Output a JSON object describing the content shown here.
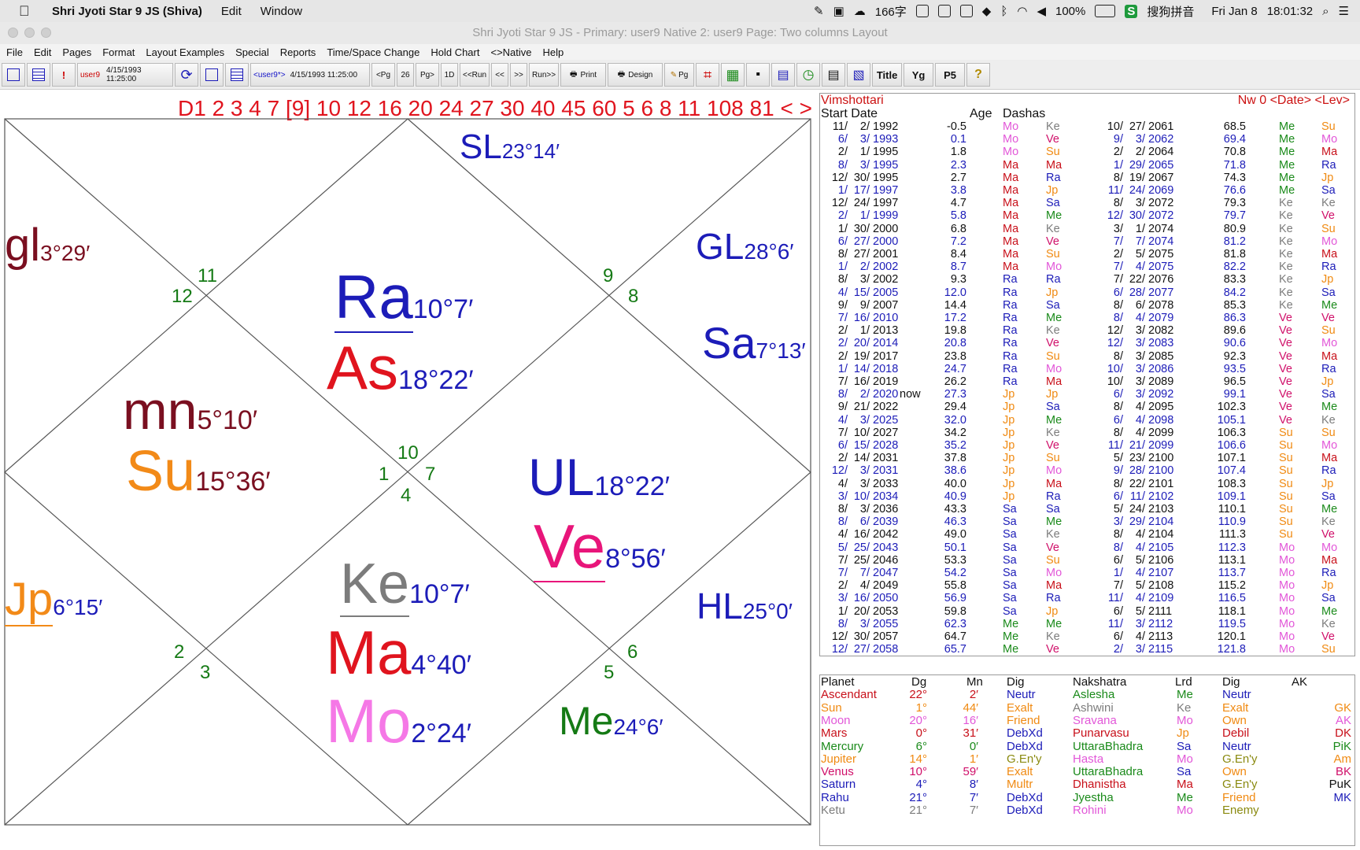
{
  "menubar": {
    "app_name": "Shri Jyoti Star 9 JS (Shiva)",
    "items": [
      "Edit",
      "Window"
    ],
    "ime_count": "166字",
    "battery": "100%",
    "ime_name": "搜狗拼音",
    "date": "Fri Jan 8",
    "time": "18:01:32"
  },
  "window": {
    "title": "Shri Jyoti Star 9 JS  -  Primary: user9      Native 2: user9      Page: Two columns Layout"
  },
  "app_menu": [
    "File",
    "Edit",
    "Pages",
    "Format",
    "Layout Examples",
    "Special",
    "Reports",
    "Time/Space Change",
    "Hold Chart",
    "<>Native",
    "Help"
  ],
  "toolbar": {
    "user1": "user9",
    "datetime1": "4/15/1993  11:25:00",
    "user2": "<user9*>",
    "datetime2": "4/15/1993  11:25:00",
    "prev_page": "<Pg",
    "page_num": "26",
    "next_page": "Pg>",
    "one_d": "1D",
    "run_back": "<<Run",
    "step_back": "<<",
    "step_fwd": ">>",
    "run_fwd": "Run>>",
    "print": "Print",
    "design": "Design",
    "pg": "Pg",
    "title": "Title",
    "yg": "Yg",
    "p5": "P5",
    "exclaim": "!"
  },
  "divisions": "D1 2 3 4 7 [9] 10 12 16 20 24 27 30 40 45 60 5 6 8 11 108 81 < >",
  "chart": {
    "house_numbers": [
      "10",
      "11",
      "12",
      "1",
      "2",
      "3",
      "4",
      "5",
      "6",
      "7",
      "8",
      "9"
    ],
    "planets": [
      {
        "abbr": "Ra",
        "deg": "10°7′",
        "color": "#1c1cb8"
      },
      {
        "abbr": "As",
        "deg": "18°22′",
        "color": "#e0141e"
      },
      {
        "abbr": "SL",
        "deg": "23°14′",
        "color": "#1c1cb8"
      },
      {
        "abbr": "gl",
        "deg": "3°29′",
        "color": "#7a0f20"
      },
      {
        "abbr": "mn",
        "deg": "5°10′",
        "color": "#7a0f20"
      },
      {
        "abbr": "Su",
        "deg": "15°36′",
        "color": "#f28a18"
      },
      {
        "abbr": "GL",
        "deg": "28°6′",
        "color": "#1c1cb8"
      },
      {
        "abbr": "Sa",
        "deg": "7°13′",
        "color": "#1c1cb8"
      },
      {
        "abbr": "UL",
        "deg": "18°22′",
        "color": "#1c1cb8"
      },
      {
        "abbr": "Ve",
        "deg": "8°56′",
        "color": "#e8157a"
      },
      {
        "abbr": "Jp",
        "deg": "6°15′",
        "color": "#f28a18"
      },
      {
        "abbr": "Ke",
        "deg": "10°7′",
        "color": "#7c7c7c"
      },
      {
        "abbr": "Ma",
        "deg": "4°40′",
        "color": "#e0141e"
      },
      {
        "abbr": "Mo",
        "deg": "2°24′",
        "color": "#f578e6"
      },
      {
        "abbr": "HL",
        "deg": "25°0′",
        "color": "#1c1cb8"
      },
      {
        "abbr": "Me",
        "deg": "24°6′",
        "color": "#157a15"
      }
    ]
  },
  "vimshottari": {
    "title": "Vimshottari",
    "options": "Nw 0 <Date> <Lev>",
    "headers": [
      "Start Date",
      "Age",
      "Dashas"
    ],
    "now_label": "now",
    "left": [
      [
        "11/",
        "2/",
        "1992",
        "-0.5",
        "Mo",
        "Ke"
      ],
      [
        "6/",
        "3/",
        "1993",
        "0.1",
        "Mo",
        "Ve"
      ],
      [
        "2/",
        "1/",
        "1995",
        "1.8",
        "Mo",
        "Su"
      ],
      [
        "8/",
        "3/",
        "1995",
        "2.3",
        "Ma",
        "Ma"
      ],
      [
        "12/",
        "30/",
        "1995",
        "2.7",
        "Ma",
        "Ra"
      ],
      [
        "1/",
        "17/",
        "1997",
        "3.8",
        "Ma",
        "Jp"
      ],
      [
        "12/",
        "24/",
        "1997",
        "4.7",
        "Ma",
        "Sa"
      ],
      [
        "2/",
        "1/",
        "1999",
        "5.8",
        "Ma",
        "Me"
      ],
      [
        "1/",
        "30/",
        "2000",
        "6.8",
        "Ma",
        "Ke"
      ],
      [
        "6/",
        "27/",
        "2000",
        "7.2",
        "Ma",
        "Ve"
      ],
      [
        "8/",
        "27/",
        "2001",
        "8.4",
        "Ma",
        "Su"
      ],
      [
        "1/",
        "2/",
        "2002",
        "8.7",
        "Ma",
        "Mo"
      ],
      [
        "8/",
        "3/",
        "2002",
        "9.3",
        "Ra",
        "Ra"
      ],
      [
        "4/",
        "15/",
        "2005",
        "12.0",
        "Ra",
        "Jp"
      ],
      [
        "9/",
        "9/",
        "2007",
        "14.4",
        "Ra",
        "Sa"
      ],
      [
        "7/",
        "16/",
        "2010",
        "17.2",
        "Ra",
        "Me"
      ],
      [
        "2/",
        "1/",
        "2013",
        "19.8",
        "Ra",
        "Ke"
      ],
      [
        "2/",
        "20/",
        "2014",
        "20.8",
        "Ra",
        "Ve"
      ],
      [
        "2/",
        "19/",
        "2017",
        "23.8",
        "Ra",
        "Su"
      ],
      [
        "1/",
        "14/",
        "2018",
        "24.7",
        "Ra",
        "Mo"
      ],
      [
        "7/",
        "16/",
        "2019",
        "26.2",
        "Ra",
        "Ma"
      ],
      [
        "8/",
        "2/",
        "2020",
        "27.3",
        "Jp",
        "Jp"
      ],
      [
        "9/",
        "21/",
        "2022",
        "29.4",
        "Jp",
        "Sa"
      ],
      [
        "4/",
        "3/",
        "2025",
        "32.0",
        "Jp",
        "Me"
      ],
      [
        "7/",
        "10/",
        "2027",
        "34.2",
        "Jp",
        "Ke"
      ],
      [
        "6/",
        "15/",
        "2028",
        "35.2",
        "Jp",
        "Ve"
      ],
      [
        "2/",
        "14/",
        "2031",
        "37.8",
        "Jp",
        "Su"
      ],
      [
        "12/",
        "3/",
        "2031",
        "38.6",
        "Jp",
        "Mo"
      ],
      [
        "4/",
        "3/",
        "2033",
        "40.0",
        "Jp",
        "Ma"
      ],
      [
        "3/",
        "10/",
        "2034",
        "40.9",
        "Jp",
        "Ra"
      ],
      [
        "8/",
        "3/",
        "2036",
        "43.3",
        "Sa",
        "Sa"
      ],
      [
        "8/",
        "6/",
        "2039",
        "46.3",
        "Sa",
        "Me"
      ],
      [
        "4/",
        "16/",
        "2042",
        "49.0",
        "Sa",
        "Ke"
      ],
      [
        "5/",
        "25/",
        "2043",
        "50.1",
        "Sa",
        "Ve"
      ],
      [
        "7/",
        "25/",
        "2046",
        "53.3",
        "Sa",
        "Su"
      ],
      [
        "7/",
        "7/",
        "2047",
        "54.2",
        "Sa",
        "Mo"
      ],
      [
        "2/",
        "4/",
        "2049",
        "55.8",
        "Sa",
        "Ma"
      ],
      [
        "3/",
        "16/",
        "2050",
        "56.9",
        "Sa",
        "Ra"
      ],
      [
        "1/",
        "20/",
        "2053",
        "59.8",
        "Sa",
        "Jp"
      ],
      [
        "8/",
        "3/",
        "2055",
        "62.3",
        "Me",
        "Me"
      ],
      [
        "12/",
        "30/",
        "2057",
        "64.7",
        "Me",
        "Ke"
      ],
      [
        "12/",
        "27/",
        "2058",
        "65.7",
        "Me",
        "Ve"
      ]
    ],
    "right": [
      [
        "10/",
        "27/",
        "2061",
        "68.5",
        "Me",
        "Su"
      ],
      [
        "9/",
        "3/",
        "2062",
        "69.4",
        "Me",
        "Mo"
      ],
      [
        "2/",
        "2/",
        "2064",
        "70.8",
        "Me",
        "Ma"
      ],
      [
        "1/",
        "29/",
        "2065",
        "71.8",
        "Me",
        "Ra"
      ],
      [
        "8/",
        "19/",
        "2067",
        "74.3",
        "Me",
        "Jp"
      ],
      [
        "11/",
        "24/",
        "2069",
        "76.6",
        "Me",
        "Sa"
      ],
      [
        "8/",
        "3/",
        "2072",
        "79.3",
        "Ke",
        "Ke"
      ],
      [
        "12/",
        "30/",
        "2072",
        "79.7",
        "Ke",
        "Ve"
      ],
      [
        "3/",
        "1/",
        "2074",
        "80.9",
        "Ke",
        "Su"
      ],
      [
        "7/",
        "7/",
        "2074",
        "81.2",
        "Ke",
        "Mo"
      ],
      [
        "2/",
        "5/",
        "2075",
        "81.8",
        "Ke",
        "Ma"
      ],
      [
        "7/",
        "4/",
        "2075",
        "82.2",
        "Ke",
        "Ra"
      ],
      [
        "7/",
        "22/",
        "2076",
        "83.3",
        "Ke",
        "Jp"
      ],
      [
        "6/",
        "28/",
        "2077",
        "84.2",
        "Ke",
        "Sa"
      ],
      [
        "8/",
        "6/",
        "2078",
        "85.3",
        "Ke",
        "Me"
      ],
      [
        "8/",
        "4/",
        "2079",
        "86.3",
        "Ve",
        "Ve"
      ],
      [
        "12/",
        "3/",
        "2082",
        "89.6",
        "Ve",
        "Su"
      ],
      [
        "12/",
        "3/",
        "2083",
        "90.6",
        "Ve",
        "Mo"
      ],
      [
        "8/",
        "3/",
        "2085",
        "92.3",
        "Ve",
        "Ma"
      ],
      [
        "10/",
        "3/",
        "2086",
        "93.5",
        "Ve",
        "Ra"
      ],
      [
        "10/",
        "3/",
        "2089",
        "96.5",
        "Ve",
        "Jp"
      ],
      [
        "6/",
        "3/",
        "2092",
        "99.1",
        "Ve",
        "Sa"
      ],
      [
        "8/",
        "4/",
        "2095",
        "102.3",
        "Ve",
        "Me"
      ],
      [
        "6/",
        "4/",
        "2098",
        "105.1",
        "Ve",
        "Ke"
      ],
      [
        "8/",
        "4/",
        "2099",
        "106.3",
        "Su",
        "Su"
      ],
      [
        "11/",
        "21/",
        "2099",
        "106.6",
        "Su",
        "Mo"
      ],
      [
        "5/",
        "23/",
        "2100",
        "107.1",
        "Su",
        "Ma"
      ],
      [
        "9/",
        "28/",
        "2100",
        "107.4",
        "Su",
        "Ra"
      ],
      [
        "8/",
        "22/",
        "2101",
        "108.3",
        "Su",
        "Jp"
      ],
      [
        "6/",
        "11/",
        "2102",
        "109.1",
        "Su",
        "Sa"
      ],
      [
        "5/",
        "24/",
        "2103",
        "110.1",
        "Su",
        "Me"
      ],
      [
        "3/",
        "29/",
        "2104",
        "110.9",
        "Su",
        "Ke"
      ],
      [
        "8/",
        "4/",
        "2104",
        "111.3",
        "Su",
        "Ve"
      ],
      [
        "8/",
        "4/",
        "2105",
        "112.3",
        "Mo",
        "Mo"
      ],
      [
        "6/",
        "5/",
        "2106",
        "113.1",
        "Mo",
        "Ma"
      ],
      [
        "1/",
        "4/",
        "2107",
        "113.7",
        "Mo",
        "Ra"
      ],
      [
        "7/",
        "5/",
        "2108",
        "115.2",
        "Mo",
        "Jp"
      ],
      [
        "11/",
        "4/",
        "2109",
        "116.5",
        "Mo",
        "Sa"
      ],
      [
        "6/",
        "5/",
        "2111",
        "118.1",
        "Mo",
        "Me"
      ],
      [
        "11/",
        "3/",
        "2112",
        "119.5",
        "Mo",
        "Ke"
      ],
      [
        "6/",
        "4/",
        "2113",
        "120.1",
        "Mo",
        "Ve"
      ],
      [
        "2/",
        "3/",
        "2115",
        "121.8",
        "Mo",
        "Su"
      ]
    ]
  },
  "planet_table": {
    "headers": [
      "Planet",
      "Dg",
      "Mn",
      "Dig",
      "Nakshatra",
      "Lrd",
      "Dig",
      "AK"
    ],
    "rows": [
      [
        "Ascendant",
        "22°",
        "2′",
        "Neutr",
        "Aslesha",
        "Me",
        "Neutr",
        ""
      ],
      [
        "Sun",
        "1°",
        "44′",
        "Exalt",
        "Ashwini",
        "Ke",
        "Exalt",
        "GK"
      ],
      [
        "Moon",
        "20°",
        "16′",
        "Friend",
        "Sravana",
        "Mo",
        "Own",
        "AK"
      ],
      [
        "Mars",
        "0°",
        "31′",
        "DebXd",
        "Punarvasu",
        "Jp",
        "Debil",
        "DK"
      ],
      [
        "Mercury",
        "6°",
        "0′",
        "DebXd",
        "UttaraBhadra",
        "Sa",
        "Neutr",
        "PiK"
      ],
      [
        "Jupiter",
        "14°",
        "1′",
        "G.En'y",
        "Hasta",
        "Mo",
        "G.En'y",
        "Am"
      ],
      [
        "Venus",
        "10°",
        "59′",
        "Exalt",
        "UttaraBhadra",
        "Sa",
        "Own",
        "BK"
      ],
      [
        "Saturn",
        "4°",
        "8′",
        "Multr",
        "Dhanistha",
        "Ma",
        "G.En'y",
        "PuK"
      ],
      [
        "Rahu",
        "21°",
        "7′",
        "DebXd",
        "Jyestha",
        "Me",
        "Friend",
        "MK"
      ],
      [
        "Ketu",
        "21°",
        "7′",
        "DebXd",
        "Rohini",
        "Mo",
        "Enemy",
        ""
      ]
    ]
  },
  "colors": {
    "Mo": "#e257d8",
    "Ma": "#c8101a",
    "Ra": "#1c1cb8",
    "Jp": "#f08a12",
    "Sa": "#1c1cb8",
    "Me": "#1a8a1a",
    "Ke": "#7c7c7c",
    "Ve": "#d0106a",
    "Su": "#f08a12",
    "date_blue": "#1c1cb8",
    "chart_red": "#e0141e",
    "house_green": "#157a15"
  }
}
